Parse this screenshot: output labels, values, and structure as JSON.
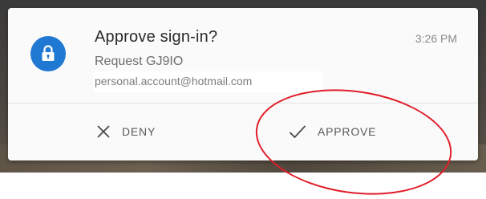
{
  "notification": {
    "title": "Approve sign-in?",
    "time": "3:26 PM",
    "request": "Request GJ9IO",
    "account": "personal.account@hotmail.com",
    "app_icon": "lock-icon",
    "accent_color": "#1f78d1"
  },
  "actions": {
    "deny": {
      "label": "DENY",
      "icon": "close-icon"
    },
    "approve": {
      "label": "APPROVE",
      "icon": "checkmark-icon"
    }
  },
  "annotation": {
    "shape": "ellipse",
    "color": "#e01e2b"
  }
}
